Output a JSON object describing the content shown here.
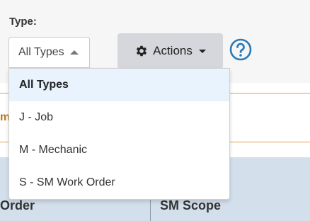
{
  "filter": {
    "label": "Type:",
    "selected_value": "All Types",
    "options": [
      "All Types",
      "J - Job",
      "M - Mechanic",
      "S - SM Work Order"
    ]
  },
  "actions": {
    "label": "Actions"
  },
  "band": {
    "partial_text": "m"
  },
  "table": {
    "columns": [
      "Order",
      "SM Scope"
    ]
  },
  "icons": {
    "actions": "gear-icon",
    "help": "help-circle-icon"
  },
  "colors": {
    "help_icon": "#2a7ab8",
    "selected_option_bg": "#e8f3fd",
    "table_header_bg": "#d3e0ec",
    "accent_line": "#d8a24a"
  }
}
